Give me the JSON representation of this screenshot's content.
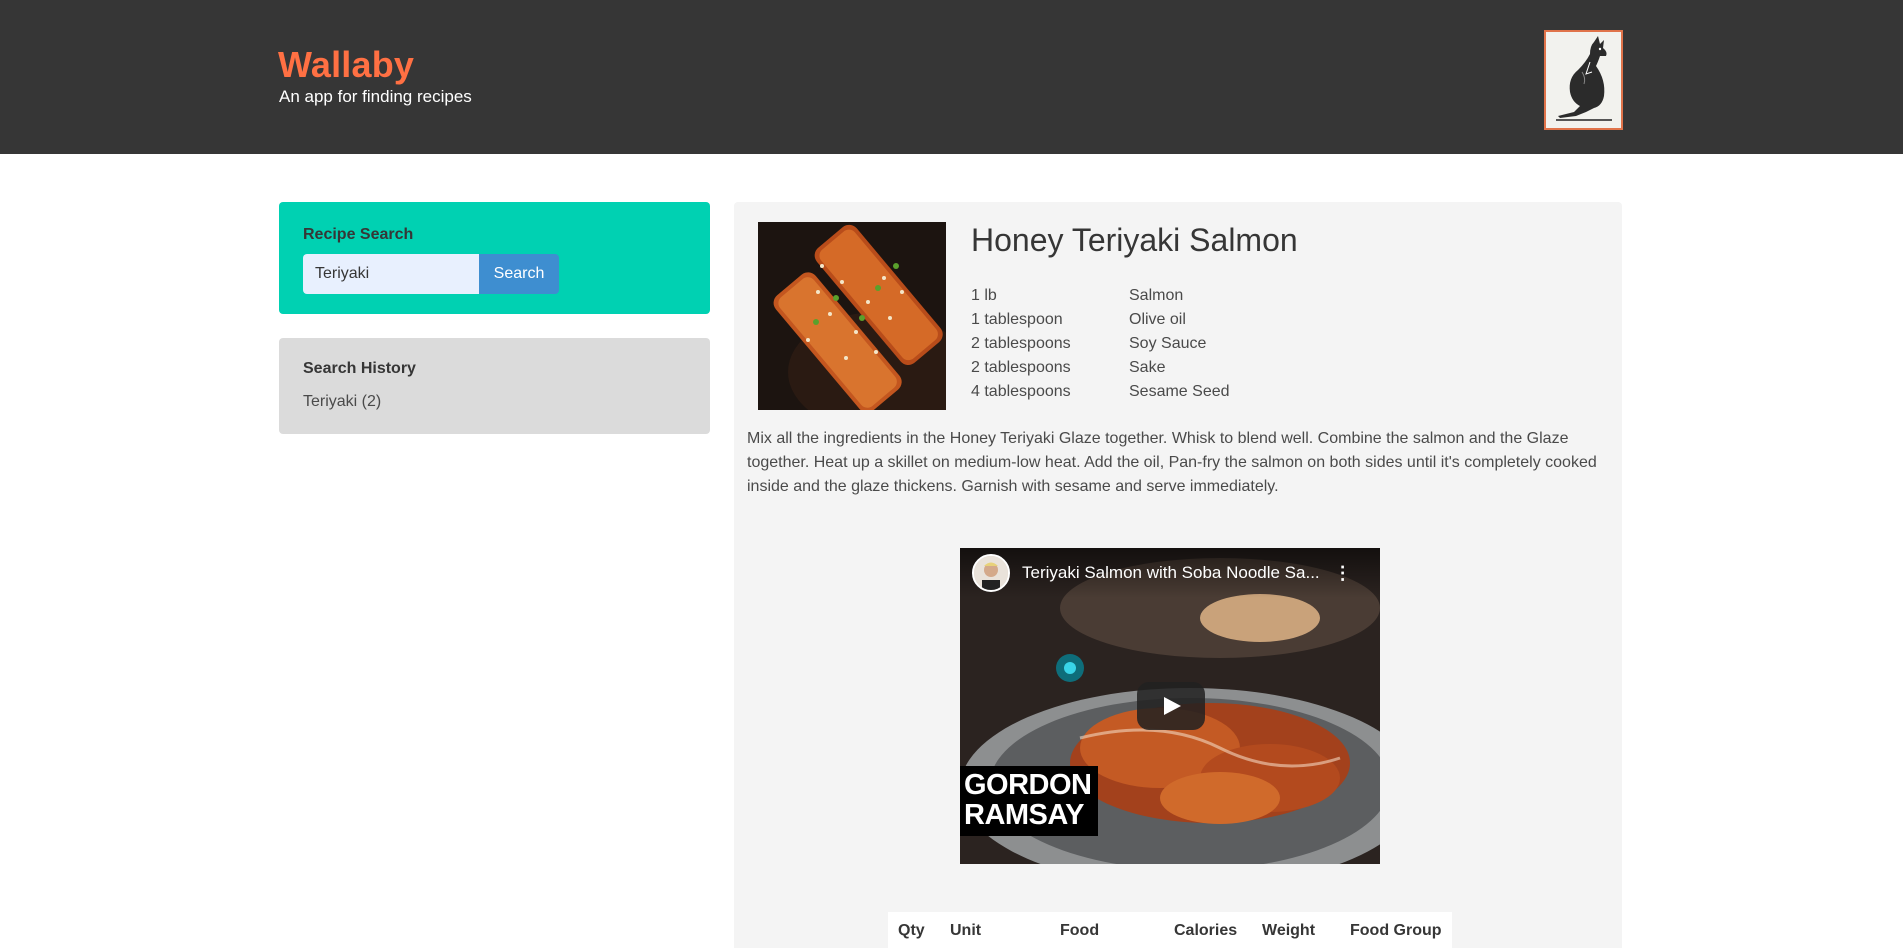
{
  "header": {
    "title": "Wallaby",
    "subtitle": "An app for finding recipes",
    "logo_icon": "kangaroo-illustration"
  },
  "colors": {
    "header_bg": "#363636",
    "brand": "#ff7043",
    "search_panel": "#00d1b2",
    "search_button": "#3e8ed0",
    "history_panel": "#dbdbdb",
    "card_bg": "#f4f4f4"
  },
  "search": {
    "title": "Recipe Search",
    "value": "Teriyaki",
    "button_label": "Search"
  },
  "history": {
    "title": "Search History",
    "items": [
      "Teriyaki (2)"
    ]
  },
  "recipe": {
    "title": "Honey Teriyaki Salmon",
    "ingredients": [
      {
        "qty": "1 lb",
        "name": "Salmon"
      },
      {
        "qty": "1 tablespoon",
        "name": "Olive oil"
      },
      {
        "qty": "2 tablespoons",
        "name": "Soy Sauce"
      },
      {
        "qty": "2 tablespoons",
        "name": "Sake"
      },
      {
        "qty": "4 tablespoons",
        "name": "Sesame Seed"
      }
    ],
    "instructions": "Mix all the ingredients in the Honey Teriyaki Glaze together. Whisk to blend well. Combine the salmon and the Glaze together. Heat up a skillet on medium-low heat. Add the oil, Pan-fry the salmon on both sides until it's completely cooked inside and the glaze thickens. Garnish with sesame and serve immediately.",
    "video": {
      "title": "Teriyaki Salmon with Soba Noodle Sa...",
      "overlay_line1": "GORDON",
      "overlay_line2": "RAMSAY"
    },
    "nutrition_headers": [
      "Qty",
      "Unit",
      "Food",
      "Calories",
      "Weight",
      "Food Group"
    ]
  }
}
